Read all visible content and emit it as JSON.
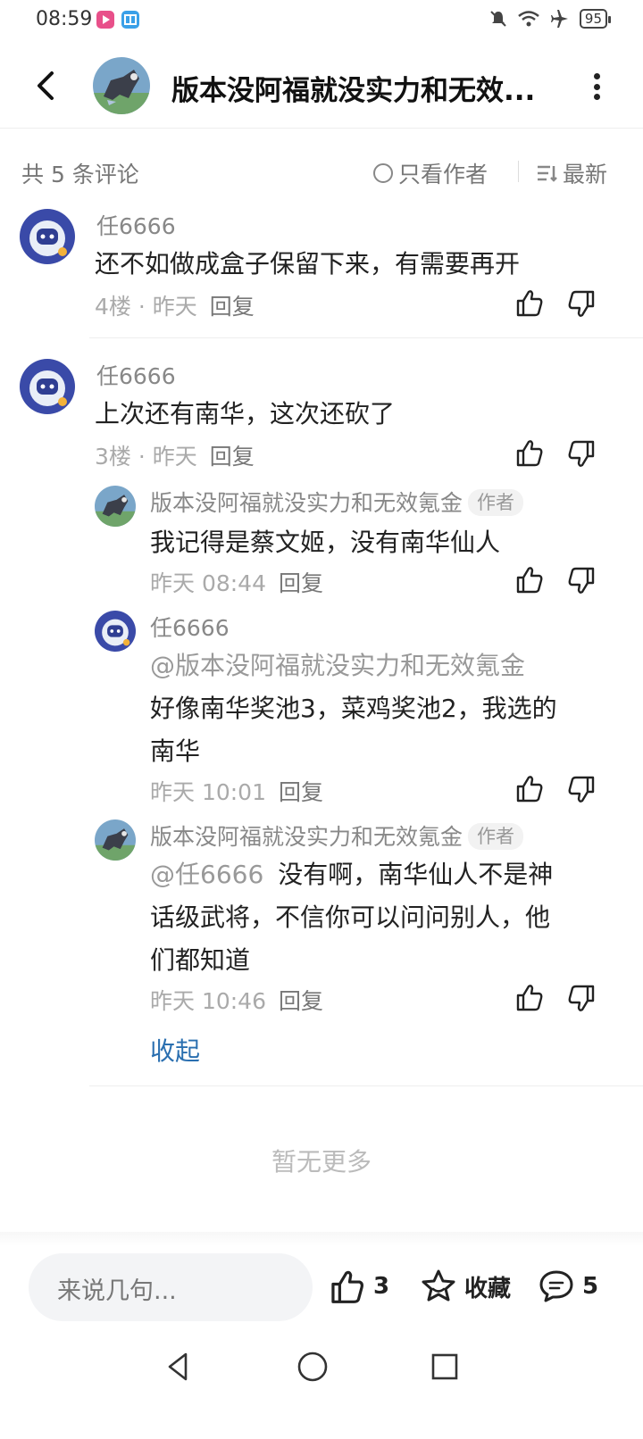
{
  "status_bar": {
    "time": "08:59",
    "battery": "95",
    "icons": [
      "video-app-icon",
      "book-app-icon",
      "mute-bell-icon",
      "wifi-icon",
      "airplane-icon",
      "battery-icon"
    ]
  },
  "header": {
    "title": "版本没阿福就没实力和无效...",
    "back_icon": "chevron-left-icon",
    "more_icon": "more-vertical-icon"
  },
  "filter": {
    "count": "共 5 条评论",
    "author_only": "只看作者",
    "sort": "最新"
  },
  "comments": [
    {
      "user": "任6666",
      "text": "还不如做成盒子保留下来，有需要再开",
      "floor": "4楼 · 昨天",
      "reply": "回复"
    },
    {
      "user": "任6666",
      "text": "上次还有南华，这次还砍了",
      "floor": "3楼 · 昨天",
      "reply": "回复",
      "replies": [
        {
          "user": "版本没阿福就没实力和无效氪金",
          "tag": "作者",
          "text": "我记得是蔡文姬，没有南华仙人",
          "time": "昨天 08:44",
          "reply": "回复"
        },
        {
          "user": "任6666",
          "mention": "@版本没阿福就没实力和无效氪金",
          "text_line1": "好像南华奖池3，菜鸡奖池2，我选的",
          "text_line2": "南华",
          "time": "昨天 10:01",
          "reply": "回复"
        },
        {
          "user": "版本没阿福就没实力和无效氪金",
          "tag": "作者",
          "mention": "@任6666",
          "text_line1": "没有啊，南华仙人不是神",
          "text_line2": "话级武将，不信你可以问问别人，他",
          "text_line3": "们都知道",
          "time": "昨天 10:46",
          "reply": "回复"
        }
      ],
      "collapse": "收起"
    }
  ],
  "no_more": "暂无更多",
  "bottom_bar": {
    "input_placeholder": "来说几句...",
    "likes": "3",
    "favorite": "收藏",
    "comments": "5"
  },
  "nav_bar": {
    "icons": [
      "nav-back-icon",
      "nav-home-icon",
      "nav-recents-icon"
    ]
  },
  "colors": {
    "link": "#2a6fb0",
    "muted": "#888888",
    "background": "#ffffff"
  }
}
